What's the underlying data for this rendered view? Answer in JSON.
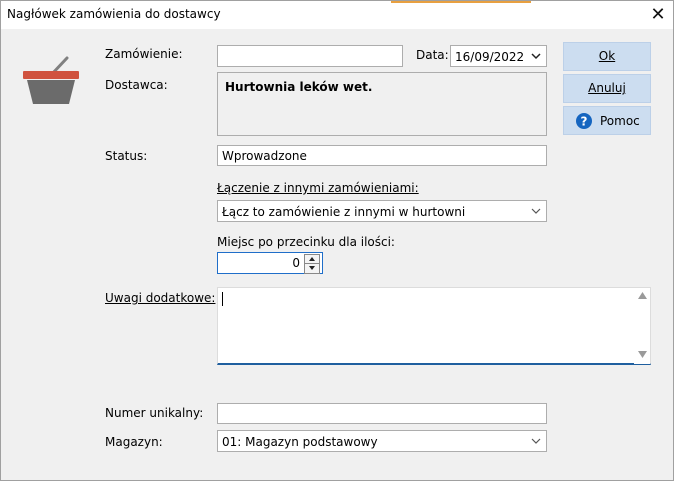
{
  "window": {
    "title": "Nagłówek zamówienia do dostawcy",
    "close_label": "✕"
  },
  "order": {
    "label": "Zamówienie:",
    "value": ""
  },
  "date": {
    "label": "Data:",
    "value": "16/09/2022"
  },
  "supplier": {
    "label": "Dostawca:",
    "value": "Hurtownia leków wet."
  },
  "status": {
    "label": "Status:",
    "value": "Wprowadzone"
  },
  "merge": {
    "label": "Łączenie z innymi zamówieniami:",
    "value": "Łącz to zamówienie z innymi w hurtowni"
  },
  "decimals": {
    "label": "Miejsc po przecinku dla ilości:",
    "value": "0"
  },
  "notes": {
    "label": "Uwagi dodatkowe:",
    "value": ""
  },
  "unique": {
    "label": "Numer unikalny:",
    "value": ""
  },
  "warehouse": {
    "label": "Magazyn:",
    "value": "01: Magazyn podstawowy"
  },
  "buttons": {
    "ok": "Ok",
    "cancel": "Anuluj",
    "help": "Pomoc"
  },
  "icons": {
    "basket": "basket-icon",
    "help": "help-icon",
    "dropdown": "chevron-down-icon"
  },
  "colors": {
    "button_bg": "#ccddf0",
    "basket_red": "#d0533f",
    "basket_gray": "#6b6b6b",
    "help_blue": "#1565c0"
  }
}
